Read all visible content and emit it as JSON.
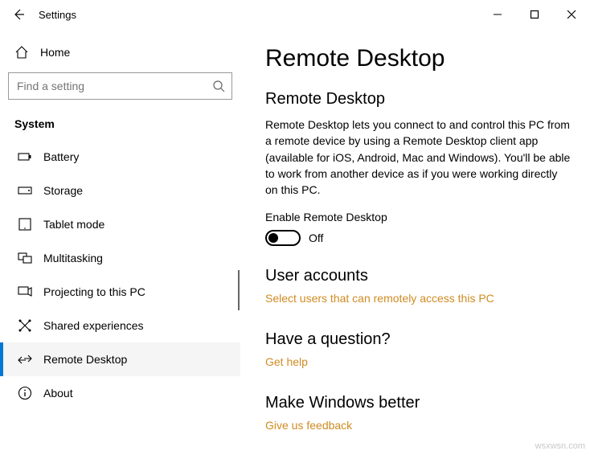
{
  "titlebar": {
    "title": "Settings"
  },
  "sidebar": {
    "home_label": "Home",
    "search_placeholder": "Find a setting",
    "category_label": "System",
    "items": [
      {
        "label": "Battery"
      },
      {
        "label": "Storage"
      },
      {
        "label": "Tablet mode"
      },
      {
        "label": "Multitasking"
      },
      {
        "label": "Projecting to this PC"
      },
      {
        "label": "Shared experiences"
      },
      {
        "label": "Remote Desktop"
      },
      {
        "label": "About"
      }
    ]
  },
  "main": {
    "page_title": "Remote Desktop",
    "section1_heading": "Remote Desktop",
    "section1_desc": "Remote Desktop lets you connect to and control this PC from a remote device by using a Remote Desktop client app (available for iOS, Android, Mac and Windows). You'll be able to work from another device as if you were working directly on this PC.",
    "toggle_label": "Enable Remote Desktop",
    "toggle_state": "Off",
    "user_accounts_heading": "User accounts",
    "user_accounts_link": "Select users that can remotely access this PC",
    "question_heading": "Have a question?",
    "question_link": "Get help",
    "improve_heading": "Make Windows better",
    "improve_link": "Give us feedback"
  },
  "watermark": "wsxwsn.com"
}
